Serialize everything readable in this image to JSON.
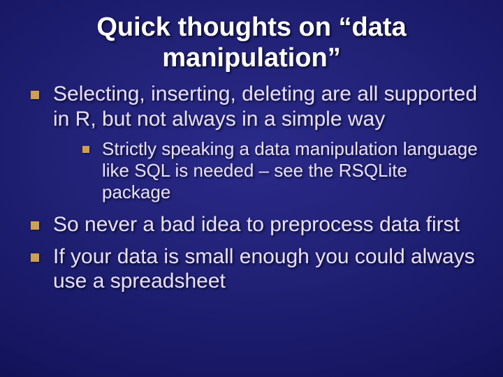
{
  "title": "Quick thoughts on “data manipulation”",
  "bullets": [
    {
      "text": "Selecting, inserting, deleting are all supported in R, but not always in a simple way",
      "sub": [
        {
          "text": "Strictly speaking a data manipulation language like SQL is needed – see the RSQLite package"
        }
      ]
    },
    {
      "text": "So never a bad  idea to preprocess data first",
      "sub": []
    },
    {
      "text": "If your data is small enough you could always use a spreadsheet",
      "sub": []
    }
  ]
}
